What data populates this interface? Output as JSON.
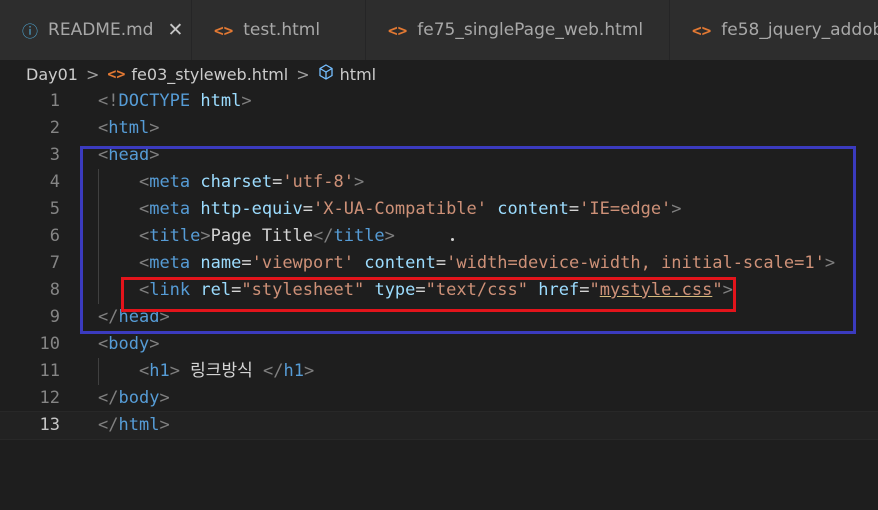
{
  "tabs": [
    {
      "label": "README.md",
      "icon": "info-icon",
      "glyph": "ⓘ",
      "close": "✕"
    },
    {
      "label": "test.html",
      "icon": "html-icon",
      "glyph": "<>"
    },
    {
      "label": "fe75_singlePage_web.html",
      "icon": "html-icon",
      "glyph": "<>"
    },
    {
      "label": "fe58_jquery_addobj",
      "icon": "html-icon",
      "glyph": "<>"
    }
  ],
  "breadcrumb": {
    "folder": "Day01",
    "file": "fe03_styleweb.html",
    "symbol": "html",
    "file_glyph": "<>",
    "sep": ">"
  },
  "lines": [
    {
      "n": "1",
      "tokens": [
        [
          "b",
          "<!"
        ],
        [
          "t",
          "DOCTYPE"
        ],
        [
          "x",
          " "
        ],
        [
          "a",
          "html"
        ],
        [
          "b",
          ">"
        ]
      ]
    },
    {
      "n": "2",
      "tokens": [
        [
          "b",
          "<"
        ],
        [
          "t",
          "html"
        ],
        [
          "b",
          ">"
        ]
      ]
    },
    {
      "n": "3",
      "tokens": [
        [
          "b",
          "<"
        ],
        [
          "t",
          "head"
        ],
        [
          "b",
          ">"
        ]
      ]
    },
    {
      "n": "4",
      "tokens": [
        [
          "x",
          "    "
        ],
        [
          "b",
          "<"
        ],
        [
          "t",
          "meta"
        ],
        [
          "x",
          " "
        ],
        [
          "a",
          "charset"
        ],
        [
          "x",
          "="
        ],
        [
          "s",
          "'utf-8'"
        ],
        [
          "b",
          ">"
        ]
      ]
    },
    {
      "n": "5",
      "tokens": [
        [
          "x",
          "    "
        ],
        [
          "b",
          "<"
        ],
        [
          "t",
          "meta"
        ],
        [
          "x",
          " "
        ],
        [
          "a",
          "http-equiv"
        ],
        [
          "x",
          "="
        ],
        [
          "s",
          "'X-UA-Compatible'"
        ],
        [
          "x",
          " "
        ],
        [
          "a",
          "content"
        ],
        [
          "x",
          "="
        ],
        [
          "s",
          "'IE=edge'"
        ],
        [
          "b",
          ">"
        ]
      ]
    },
    {
      "n": "6",
      "tokens": [
        [
          "x",
          "    "
        ],
        [
          "b",
          "<"
        ],
        [
          "t",
          "title"
        ],
        [
          "b",
          ">"
        ],
        [
          "x",
          "Page Title"
        ],
        [
          "b",
          "</"
        ],
        [
          "t",
          "title"
        ],
        [
          "b",
          ">"
        ]
      ]
    },
    {
      "n": "7",
      "tokens": [
        [
          "x",
          "    "
        ],
        [
          "b",
          "<"
        ],
        [
          "t",
          "meta"
        ],
        [
          "x",
          " "
        ],
        [
          "a",
          "name"
        ],
        [
          "x",
          "="
        ],
        [
          "s",
          "'viewport'"
        ],
        [
          "x",
          " "
        ],
        [
          "a",
          "content"
        ],
        [
          "x",
          "="
        ],
        [
          "s",
          "'width=device-width, initial-scale=1'"
        ],
        [
          "b",
          ">"
        ]
      ]
    },
    {
      "n": "8",
      "tokens": [
        [
          "x",
          "    "
        ],
        [
          "b",
          "<"
        ],
        [
          "t",
          "link"
        ],
        [
          "x",
          " "
        ],
        [
          "a",
          "rel"
        ],
        [
          "x",
          "="
        ],
        [
          "s",
          "\"stylesheet\""
        ],
        [
          "x",
          " "
        ],
        [
          "a",
          "type"
        ],
        [
          "x",
          "="
        ],
        [
          "s",
          "\"text/css\""
        ],
        [
          "x",
          " "
        ],
        [
          "a",
          "href"
        ],
        [
          "x",
          "="
        ],
        [
          "s",
          "\""
        ],
        [
          "s u",
          "mystyle.css"
        ],
        [
          "s",
          "\""
        ],
        [
          "b",
          ">"
        ]
      ]
    },
    {
      "n": "9",
      "tokens": [
        [
          "b",
          "</"
        ],
        [
          "t",
          "head"
        ],
        [
          "b",
          ">"
        ]
      ]
    },
    {
      "n": "10",
      "tokens": [
        [
          "b",
          "<"
        ],
        [
          "t",
          "body"
        ],
        [
          "b",
          ">"
        ]
      ]
    },
    {
      "n": "11",
      "tokens": [
        [
          "x",
          "    "
        ],
        [
          "b",
          "<"
        ],
        [
          "t",
          "h1"
        ],
        [
          "b",
          ">"
        ],
        [
          "x",
          " 링크방식 "
        ],
        [
          "b",
          "</"
        ],
        [
          "t",
          "h1"
        ],
        [
          "b",
          ">"
        ]
      ]
    },
    {
      "n": "12",
      "tokens": [
        [
          "b",
          "</"
        ],
        [
          "t",
          "body"
        ],
        [
          "b",
          ">"
        ]
      ]
    },
    {
      "n": "13",
      "tokens": [
        [
          "b",
          "</"
        ],
        [
          "t",
          "html"
        ],
        [
          "b",
          ">"
        ]
      ]
    }
  ],
  "current_line": "13",
  "highlights": {
    "head_box_color": "#3b3bbf",
    "link_box_color": "#e3141b"
  }
}
